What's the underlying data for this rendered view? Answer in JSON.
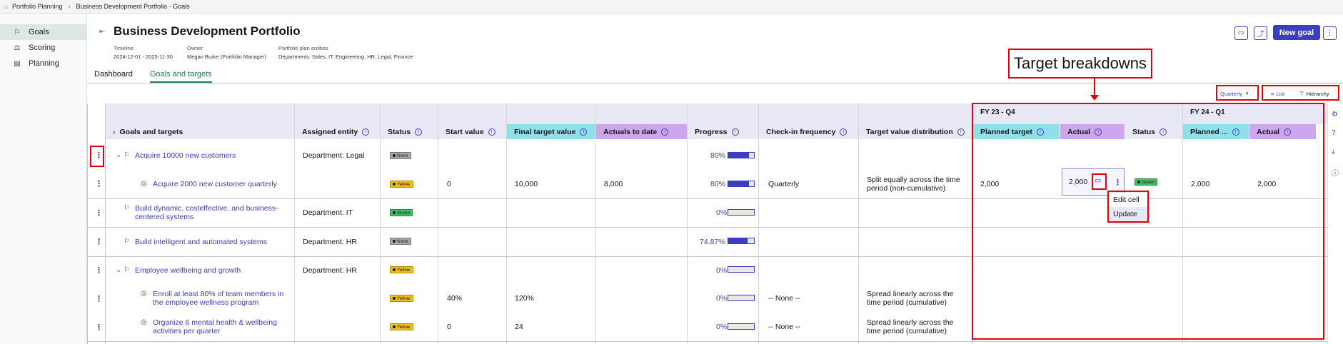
{
  "breadcrumb": {
    "root": "Portfolio Planning",
    "current": "Business Development Portfolio - Goals"
  },
  "nav": {
    "items": [
      {
        "label": "Goals"
      },
      {
        "label": "Scoring"
      },
      {
        "label": "Planning"
      }
    ]
  },
  "header": {
    "title": "Business Development Portfolio",
    "timeline_label": "Timeline",
    "timeline_value": "2024-12-01 - 2025-11-30",
    "owner_label": "Owner",
    "owner_value": "Megan Burke (Portfolio Manager)",
    "entities_label": "Portfolio plan entities",
    "entities_value": "Departments: Sales, IT, Engineering, HR, Legal, Finance",
    "new_goal": "New goal"
  },
  "tabs": [
    {
      "label": "Dashboard"
    },
    {
      "label": "Goals and targets"
    }
  ],
  "toolbar": {
    "period": "Quarterly",
    "list": "List",
    "hierarchy": "Hierarchy"
  },
  "annotation": {
    "callout": "Target breakdowns"
  },
  "fy": [
    "FY 23 - Q4",
    "FY 24 - Q1"
  ],
  "columns": {
    "goals": "Goals and targets",
    "entity": "Assigned entity",
    "status": "Status",
    "start": "Start value",
    "final": "Final target value",
    "actuals": "Actuals to date",
    "progress": "Progress",
    "checkin": "Check-in frequency",
    "distribution": "Target value distribution",
    "planned": "Planned target",
    "actual": "Actual",
    "status2": "Status",
    "planned2": "Planned ...",
    "actual2": "Actual"
  },
  "rows": [
    {
      "name": "Acquire 10000 new customers",
      "entity": "Department: Legal",
      "status": "None",
      "progress": "80%",
      "progress_value": 0.8
    },
    {
      "name": "Acquire 2000 new customer quarterly",
      "status": "Yellow",
      "start": "0",
      "final": "10,000",
      "actuals": "8,000",
      "progress": "80%",
      "progress_value": 0.8,
      "checkin": "Quarterly",
      "distribution": "Split equally across the time period (non-cumulative)",
      "planned": "2,000",
      "actual": "2,000",
      "status2": "Green",
      "planned2": "2,000",
      "actual2": "2,000"
    },
    {
      "name": "Build dynamic, costeffective, and business-centered systems",
      "entity": "Department: IT",
      "status": "Green",
      "progress": "0%",
      "progress_value": 0
    },
    {
      "name": "Build intelligent and automated systems",
      "entity": "Department: HR",
      "status": "None",
      "progress": "74.87%",
      "progress_value": 0.7487
    },
    {
      "name": "Employee wellbeing and growth",
      "entity": "Department: HR",
      "status": "Yellow",
      "progress": "0%",
      "progress_value": 0
    },
    {
      "name": "Enroll at least 80% of team members in the employee wellness program",
      "status": "Yellow",
      "start": "40%",
      "final": "120%",
      "progress": "0%",
      "progress_value": 0,
      "checkin": "-- None --",
      "distribution": "Spread linearly across the time period (cumulative)"
    },
    {
      "name": "Organize 6 mental health & wellbeing activities per quarter",
      "status": "Yellow",
      "start": "0",
      "final": "24",
      "progress": "0%",
      "progress_value": 0,
      "checkin": "-- None --",
      "distribution": "Spread linearly across the time period (cumulative)"
    }
  ],
  "menu": {
    "edit": "Edit cell",
    "update": "Update"
  },
  "colors": {
    "accent": "#3d3dbf",
    "green": "#1a7f5a",
    "annotation": "#e0000a"
  }
}
